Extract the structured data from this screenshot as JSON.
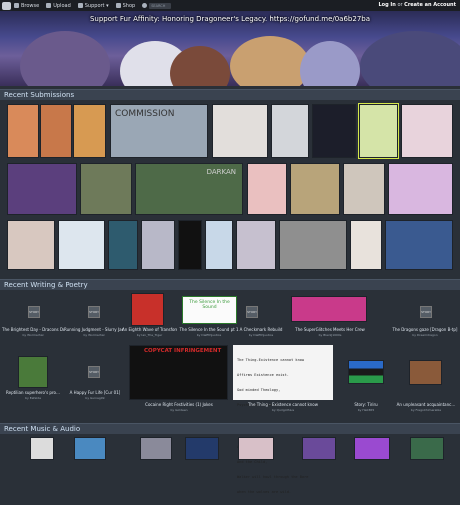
{
  "topbar": {
    "nav": [
      {
        "label": "Browse",
        "icon": "browse-icon"
      },
      {
        "label": "Upload",
        "icon": "upload-icon"
      },
      {
        "label": "Support ▾",
        "icon": "support-icon"
      },
      {
        "label": "Shop",
        "icon": "shop-icon"
      }
    ],
    "search_placeholder": "SEARCH",
    "login": "Log In",
    "or": " or ",
    "create": "Create an Account"
  },
  "banner": {
    "title": "Support Fur Affinity: Honoring Dragoneer's Legacy. https://gofund.me/0a6b27ba"
  },
  "sections": {
    "recent_submissions": "Recent Submissions",
    "recent_writing": "Recent Writing & Poetry",
    "recent_music": "Recent Music & Audio"
  },
  "submissions": {
    "row1_colors": [
      "#d98a5a",
      "#c8784a",
      "#d79a52",
      "#9aa7b5",
      "#cfd2d6",
      "#e2dedb",
      "#d24a4a",
      "#d3d6da",
      "#1c1e2a",
      "#d5e4a8",
      "#e8d3dc"
    ],
    "row2_colors": [
      "#5b3f7d",
      "#6e7a5a",
      "#b9c8a0",
      "#4e6a48",
      "#eac0c0",
      "#b8a47a",
      "#cfc6bc",
      "#d9b7e0"
    ],
    "row3_colors": [
      "#d8c8c0",
      "#dde6ee",
      "#2e5b6e",
      "#b8b8c8",
      "#c8d8e8",
      "#c6c0cf",
      "#8f8f8f",
      "#e8e2dc",
      "#3a5a90"
    ],
    "overlay_texts": {
      "commission": "COMMISSION",
      "darkan": "DARKAN"
    }
  },
  "writing": {
    "row1": [
      {
        "title": "The Brightest Day - Dracons Dominion P1",
        "by": "by Wormarhal"
      },
      {
        "title": "Running Judgment - Slurry Jackal",
        "by": "by Wormarhal"
      },
      {
        "title": "An Eighth Wave of Transformation (Chapter 11)",
        "by": "by Ian_The_Tiger"
      },
      {
        "title": "The Silence In the Sound pt 1",
        "by": "by DaiEthJustice"
      },
      {
        "title": "A Checkmark Rebuild",
        "by": "by DaiEthJustice"
      },
      {
        "title": "The SuperGlitches Meets Her Crew",
        "by": "by BlackJ1000s"
      },
      {
        "title": "The Dragons gaze [Dragon B-tp]",
        "by": "by Dreamdragon"
      }
    ],
    "row2": [
      {
        "title": "Reptilian superhero's pro…",
        "by": "by Eefelda"
      },
      {
        "title": "A Happy Fur Life [Cur 01]",
        "by": "by Guinag09"
      },
      {
        "title": "Cocaine Right Festivities (1) Jokes",
        "by": "by Goldeen"
      },
      {
        "title": "The Thing - Existence cannot know",
        "by": "by Quirgothius"
      },
      {
        "title": "Story: Tiriru",
        "by": "by Ha03R5"
      },
      {
        "title": "An unpleasant acquaintanc…",
        "by": "by FregoChimerable"
      }
    ],
    "story_label": "STORY",
    "silence_text": "The Silence In the Sound",
    "copycat_text": "COPYCAT INFRINGEMENT",
    "poem_lines": [
      "The Thing-Existence cannot know",
      "Affirms Existence exist.",
      "God minded Theology,",
      "Psycho-Ice Universe",
      "",
      "Love-accounts the artist",
      "And the Loveless",
      "And the Child,",
      "Walker will howl through the Bare",
      "when the wolves are wild."
    ]
  },
  "music": {
    "colors": [
      "#dcdcdc",
      "#4a89c0",
      "#8a8a9a",
      "#233a6a",
      "#d8c0c8",
      "#6a4a9a",
      "#9a4ad0",
      "#3a6a4a"
    ]
  }
}
